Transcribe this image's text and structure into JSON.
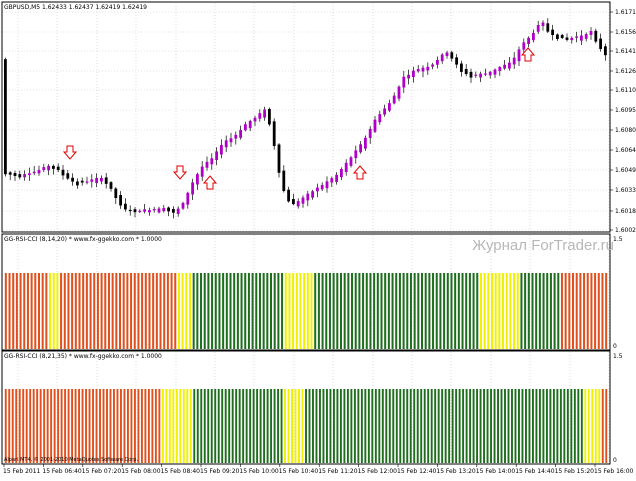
{
  "main_chart": {
    "info_text": "GBPUSD,M5  1.62433 1.62437 1.62419 1.62419",
    "price_labels": [
      "1.61715",
      "1.61565",
      "1.61410",
      "1.61260",
      "1.61105",
      "1.60955",
      "1.60800",
      "1.60645",
      "1.60490",
      "1.60335",
      "1.60180",
      "1.60025"
    ],
    "bull_color": "#b000c8",
    "bear_color": "#000000",
    "arrow_color": "#e00000",
    "grid_color": "#c8c8c8"
  },
  "indicator_1": {
    "title": "GG-RSI-CCI (8,14,20) * www.fx-ggekko.com * 1.0000",
    "scale_top": "1.5",
    "scale_bottom": "0"
  },
  "indicator_2": {
    "title": "GG-RSI-CCI (8,21,35) * www.fx-ggekko.com * 1.0000",
    "scale_top": "1.5",
    "scale_bottom": "0"
  },
  "watermark": "Журнал ForTrader.ru",
  "copyright": "Alpari MT4, © 2001-2010 MetaQuotes Software Corp.",
  "time_labels": [
    "15 Feb 2011",
    "15 Feb 06:40",
    "15 Feb 07:20",
    "15 Feb 08:00",
    "15 Feb 08:40",
    "15 Feb 09:20",
    "15 Feb 10:00",
    "15 Feb 10:40",
    "15 Feb 11:20",
    "15 Feb 12:00",
    "15 Feb 12:40",
    "15 Feb 13:20",
    "15 Feb 14:00",
    "15 Feb 14:40",
    "15 Feb 15:20",
    "15 Feb 16:00"
  ],
  "colors": {
    "red": "#e0501e",
    "yellow": "#f0f000",
    "green": "#1e6e1e"
  },
  "indicator_1_segments": [
    {
      "color": "red",
      "count": 12
    },
    {
      "color": "yellow",
      "count": 3
    },
    {
      "color": "red",
      "count": 32
    },
    {
      "color": "yellow",
      "count": 4
    },
    {
      "color": "green",
      "count": 25
    },
    {
      "color": "yellow",
      "count": 8
    },
    {
      "color": "green",
      "count": 45
    },
    {
      "color": "yellow",
      "count": 11
    },
    {
      "color": "green",
      "count": 11
    },
    {
      "color": "red",
      "count": 13
    }
  ],
  "indicator_2_segments": [
    {
      "color": "red",
      "count": 45
    },
    {
      "color": "yellow",
      "count": 9
    },
    {
      "color": "green",
      "count": 26
    },
    {
      "color": "yellow",
      "count": 6
    },
    {
      "color": "green",
      "count": 80
    },
    {
      "color": "yellow",
      "count": 5
    },
    {
      "color": "red",
      "count": 2
    }
  ]
}
